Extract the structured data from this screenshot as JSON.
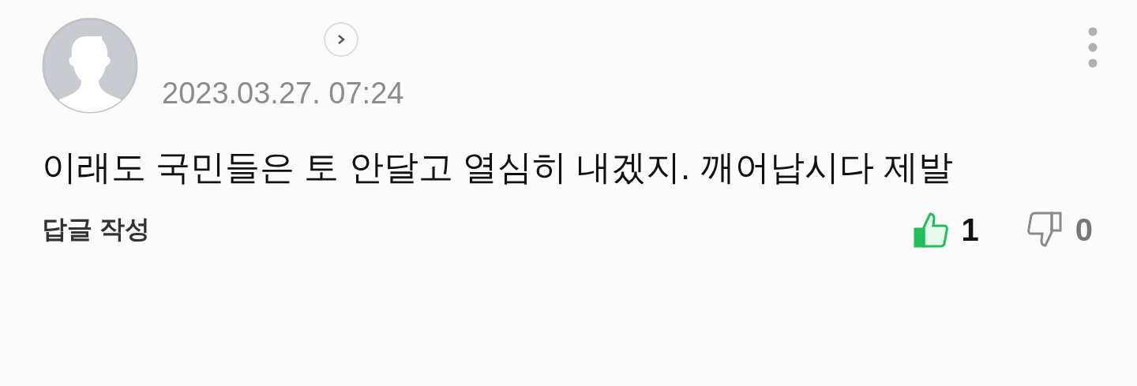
{
  "comment": {
    "timestamp": "2023.03.27. 07:24",
    "text": "이래도 국민들은 토 안달고 열심히 내겠지. 깨어납시다 제발",
    "reply_label": "답글 작성",
    "reactions": [
      {
        "kind": "like",
        "count": "1",
        "selected": true
      },
      {
        "kind": "dislike",
        "count": "0",
        "selected": false
      }
    ]
  }
}
